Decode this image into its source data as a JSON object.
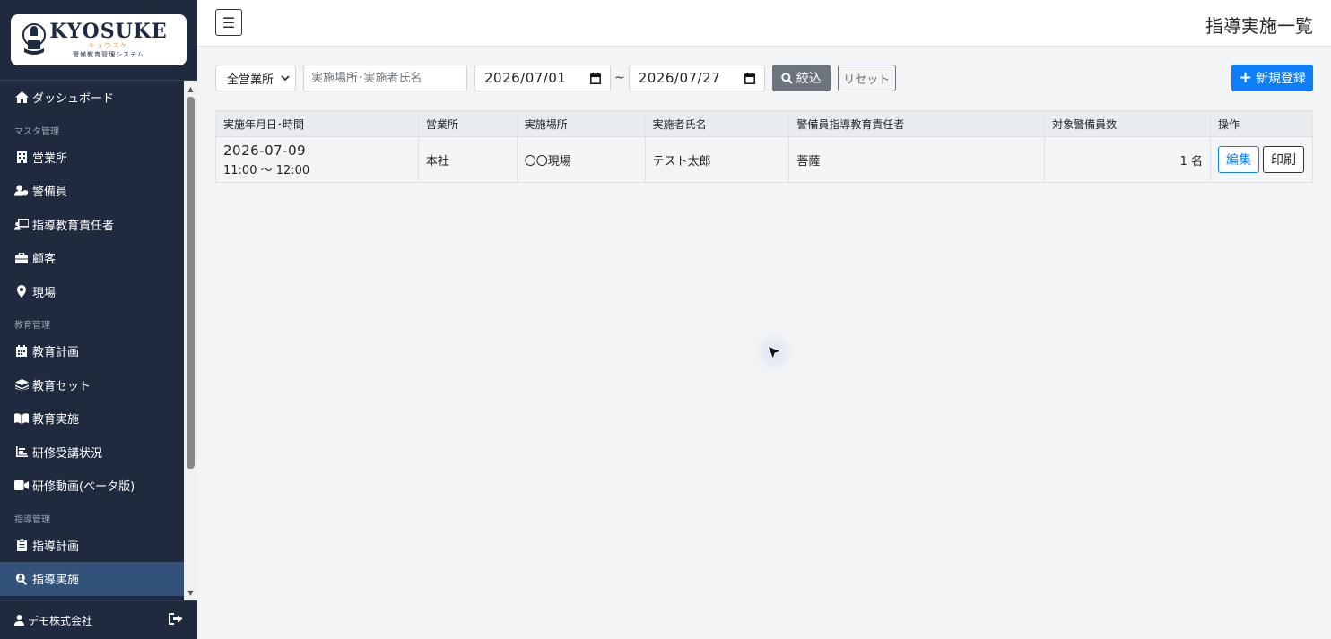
{
  "brand": {
    "name": "KYOSUKE",
    "kana": "キョウスケ",
    "subtitle": "警備教育管理システム"
  },
  "sidebar": {
    "items": [
      {
        "type": "item",
        "label": "ダッシュボード",
        "icon": "home-icon"
      },
      {
        "type": "section",
        "label": "マスタ管理"
      },
      {
        "type": "item",
        "label": "営業所",
        "icon": "building-icon"
      },
      {
        "type": "item",
        "label": "警備員",
        "icon": "user-shield-icon"
      },
      {
        "type": "item",
        "label": "指導教育責任者",
        "icon": "chalkboard-teacher-icon"
      },
      {
        "type": "item",
        "label": "顧客",
        "icon": "briefcase-icon"
      },
      {
        "type": "item",
        "label": "現場",
        "icon": "map-pin-icon"
      },
      {
        "type": "section",
        "label": "教育管理"
      },
      {
        "type": "item",
        "label": "教育計画",
        "icon": "calendar-icon"
      },
      {
        "type": "item",
        "label": "教育セット",
        "icon": "layers-icon"
      },
      {
        "type": "item",
        "label": "教育実施",
        "icon": "book-open-icon"
      },
      {
        "type": "item",
        "label": "研修受講状況",
        "icon": "chart-bar-icon"
      },
      {
        "type": "item",
        "label": "研修動画(ベータ版)",
        "icon": "video-icon"
      },
      {
        "type": "section",
        "label": "指導管理"
      },
      {
        "type": "item",
        "label": "指導計画",
        "icon": "clipboard-icon"
      },
      {
        "type": "item",
        "label": "指導実施",
        "icon": "search-person-icon",
        "active": true
      }
    ],
    "footer": {
      "company": "デモ株式会社",
      "user_icon": "user-icon",
      "logout_icon": "logout-icon"
    }
  },
  "header": {
    "menu_icon": "hamburger-icon",
    "title": "指導実施一覧"
  },
  "filter": {
    "office_select": "全営業所",
    "search_placeholder": "実施場所･実施者氏名",
    "date_from": "2026/07/01",
    "separator": "~",
    "date_to": "2026/07/27",
    "search_label": "絞込",
    "reset_label": "リセット",
    "new_label": "新規登録"
  },
  "table": {
    "headers": [
      "実施年月日･時間",
      "営業所",
      "実施場所",
      "実施者氏名",
      "警備員指導教育責任者",
      "対象警備員数",
      "操作"
    ],
    "rows": [
      {
        "date": "2026-07-09",
        "time": "11:00 ～ 12:00",
        "office": "本社",
        "location": "〇〇現場",
        "instructor": "テスト太郎",
        "supervisor": "菩薩",
        "count": "1 名",
        "edit_label": "編集",
        "print_label": "印刷"
      }
    ]
  },
  "colors": {
    "sidebar_bg": "#1f2a3f",
    "active_item": "#33527a",
    "primary": "#0d7ef7",
    "secondary": "#6c757d"
  }
}
